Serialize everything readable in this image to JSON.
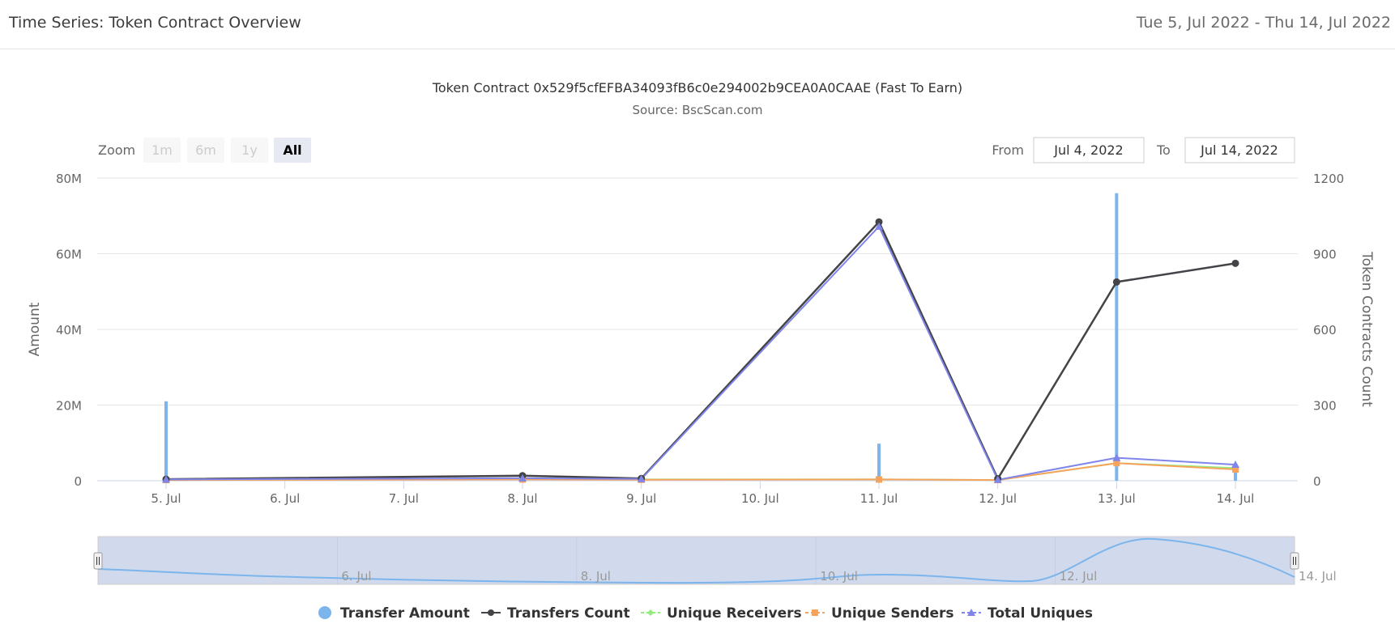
{
  "header": {
    "title": "Time Series: Token Contract Overview",
    "date_range": "Tue 5, Jul 2022 - Thu 14, Jul 2022"
  },
  "controls": {
    "zoom_label": "Zoom",
    "zoom_buttons": [
      "1m",
      "6m",
      "1y",
      "All"
    ],
    "zoom_active": "All",
    "from_label": "From",
    "from_value": "Jul 4, 2022",
    "to_label": "To",
    "to_value": "Jul 14, 2022"
  },
  "colors": {
    "transfer_amount": "#7cb5ec",
    "transfers_count": "#434348",
    "unique_receivers": "#90ed7d",
    "unique_senders": "#f7a35c",
    "total_uniques": "#8085e9"
  },
  "chart_data": {
    "type": "line",
    "title": "Token Contract 0x529f5cfEFBA34093fB6c0e294002b9CEA0A0CAAE (Fast To Earn)",
    "subtitle": "Source: BscScan.com",
    "x": [
      "5. Jul",
      "6. Jul",
      "7. Jul",
      "8. Jul",
      "9. Jul",
      "10. Jul",
      "11. Jul",
      "12. Jul",
      "13. Jul",
      "14. Jul"
    ],
    "x_day": [
      5,
      8,
      9,
      11,
      12,
      13,
      14
    ],
    "ylabel_left": "Amount",
    "ylabel_right": "Token Contracts Count",
    "ylim_left": [
      0,
      80000000
    ],
    "ylim_right": [
      0,
      1200
    ],
    "yticks_left": [
      "0",
      "20M",
      "40M",
      "60M",
      "80M"
    ],
    "yticks_right": [
      "0",
      "300",
      "600",
      "900",
      "1200"
    ],
    "grid": true,
    "legend_position": "bottom",
    "series": [
      {
        "name": "Transfer Amount",
        "type": "column",
        "axis": "left",
        "values": [
          21000000,
          300000,
          300000,
          9800000,
          300000,
          76000000,
          2500000
        ]
      },
      {
        "name": "Transfers Count",
        "type": "line",
        "axis": "right",
        "values": [
          6,
          20,
          9,
          1026,
          8,
          788,
          862
        ]
      },
      {
        "name": "Unique Receivers",
        "type": "line",
        "axis": "right",
        "values": [
          3,
          6,
          5,
          5,
          3,
          70,
          50
        ]
      },
      {
        "name": "Unique Senders",
        "type": "line",
        "axis": "right",
        "values": [
          3,
          5,
          4,
          5,
          3,
          70,
          45
        ]
      },
      {
        "name": "Total Uniques",
        "type": "line",
        "axis": "right",
        "values": [
          5,
          10,
          7,
          1008,
          4,
          91,
          64
        ]
      }
    ],
    "navigator": {
      "labels": [
        "6. Jul",
        "8. Jul",
        "10. Jul",
        "12. Jul",
        "14. Jul"
      ]
    }
  }
}
